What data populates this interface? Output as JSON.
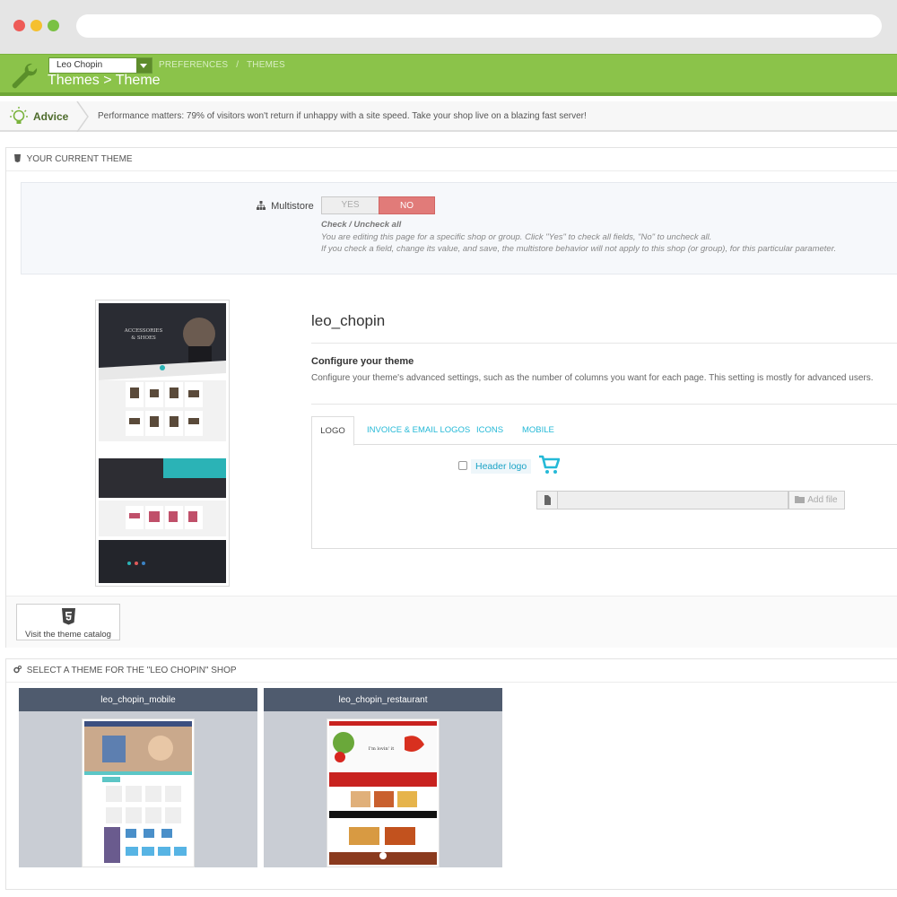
{
  "header": {
    "shop_select": "Leo Chopin",
    "breadcrumb": [
      "PREFERENCES",
      "/",
      "THEMES"
    ],
    "title": "Themes > Theme"
  },
  "advice": {
    "label": "Advice",
    "text": "Performance matters: 79% of visitors won't return if unhappy with a site speed. Take your shop live on a blazing fast server!"
  },
  "current_theme": {
    "heading": "YOUR CURRENT THEME",
    "multistore": {
      "label": "Multistore",
      "yes": "YES",
      "no": "NO",
      "selected": "NO",
      "help_title": "Check / Uncheck all",
      "help_line1": "You are editing this page for a specific shop or group. Click \"Yes\" to check all fields, \"No\" to uncheck all.",
      "help_line2": "If you check a field, change its value, and save, the multistore behavior will not apply to this shop (or group), for this particular parameter."
    },
    "preview": {
      "hero_line1": "ACCESSORIES",
      "hero_line2": "& SHOES"
    },
    "theme_name": "leo_chopin",
    "configure_title": "Configure your theme",
    "configure_text": "Configure your theme's advanced settings, such as the number of columns you want for each page. This setting is mostly for advanced users.",
    "tabs": [
      {
        "label": "LOGO",
        "active": true
      },
      {
        "label": "INVOICE & EMAIL LOGOS",
        "active": false
      },
      {
        "label": "ICONS",
        "active": false
      },
      {
        "label": "MOBILE",
        "active": false
      }
    ],
    "logo": {
      "checkbox_label": "Header logo",
      "add_file": "Add file"
    },
    "catalog_button": "Visit the theme catalog"
  },
  "select_theme": {
    "heading": "SELECT A THEME FOR THE \"LEO CHOPIN\" SHOP",
    "themes": [
      {
        "name": "leo_chopin_mobile"
      },
      {
        "name": "leo_chopin_restaurant",
        "thumb_text": "I'm lovin' it"
      }
    ]
  },
  "colors": {
    "header_green": "#8bc34a",
    "accent_blue": "#25b9d7",
    "no_red": "#e17b79",
    "card_head": "#4f5b6e"
  }
}
